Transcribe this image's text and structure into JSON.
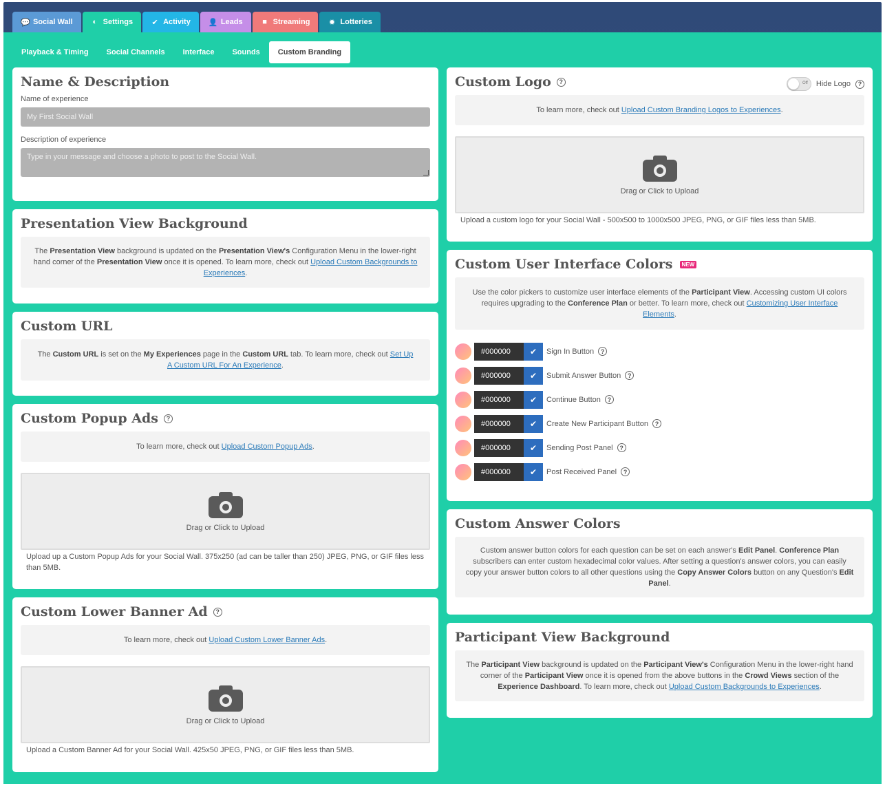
{
  "tabs_top": [
    {
      "label": "Social Wall",
      "icon": "chat-bubble-icon",
      "color": "#5b9ad6"
    },
    {
      "label": "Settings",
      "icon": "toggle-icon",
      "color": "#1fcfa8"
    },
    {
      "label": "Activity",
      "icon": "check-circle-icon",
      "color": "#23b6e6"
    },
    {
      "label": "Leads",
      "icon": "user-icon",
      "color": "#c58ee8"
    },
    {
      "label": "Streaming",
      "icon": "video-camera-icon",
      "color": "#f07a7a"
    },
    {
      "label": "Lotteries",
      "icon": "gear-burst-icon",
      "color": "#1a8fa6"
    }
  ],
  "subtabs": [
    "Playback & Timing",
    "Social Channels",
    "Interface",
    "Sounds",
    "Custom Branding"
  ],
  "name_desc": {
    "title": "Name & Description",
    "name_label": "Name of experience",
    "name_placeholder": "My First Social Wall",
    "desc_label": "Description of experience",
    "desc_placeholder": "Type in your message and choose a photo to post to the Social Wall."
  },
  "presentation_bg": {
    "title": "Presentation View Background",
    "t1": "The ",
    "b1": "Presentation View",
    "t2": " background is updated on the ",
    "b2": "Presentation View's",
    "t3": " Configuration Menu in the lower-right hand corner of the ",
    "b3": "Presentation View",
    "t4": " once it is opened. To learn more, check out ",
    "link": "Upload Custom Backgrounds to Experiences",
    "t5": "."
  },
  "custom_url": {
    "title": "Custom URL",
    "t1": "The ",
    "b1": "Custom URL",
    "t2": " is set on the ",
    "b2": "My Experiences",
    "t3": " page in the ",
    "b3": "Custom URL",
    "t4": " tab. To learn more, check out ",
    "link": "Set Up A Custom URL For An Experience",
    "t5": "."
  },
  "popup_ads": {
    "title": "Custom Popup Ads",
    "info_text": "To learn more, check out ",
    "link": "Upload Custom Popup Ads",
    "upload_text": "Drag or Click to Upload",
    "note": "Upload up a Custom Popup Ads for your Social Wall. 375x250 (ad can be taller than 250) JPEG, PNG, or GIF files less than 5MB."
  },
  "lower_banner": {
    "title": "Custom Lower Banner Ad",
    "info_text": "To learn more, check out ",
    "link": "Upload Custom Lower Banner Ads",
    "upload_text": "Drag or Click to Upload",
    "note": "Upload a Custom Banner Ad for your Social Wall. 425x50 JPEG, PNG, or GIF files less than 5MB."
  },
  "custom_logo": {
    "title": "Custom Logo",
    "toggle_off": "Off",
    "hide_label": "Hide Logo",
    "info_text": "To learn more, check out ",
    "link": "Upload Custom Branding Logos to Experiences",
    "upload_text": "Drag or Click to Upload",
    "note": "Upload a custom logo for your Social Wall - 500x500 to 1000x500 JPEG, PNG, or GIF files less than 5MB."
  },
  "ui_colors": {
    "title": "Custom User Interface Colors",
    "badge": "NEW",
    "t1": "Use the color pickers to customize user interface elements of the ",
    "b1": "Participant View",
    "t2": ". Accessing custom UI colors requires upgrading to the ",
    "b2": "Conference Plan",
    "t3": " or better. To learn more, check out ",
    "link": "Customizing User Interface Elements",
    "t4": ".",
    "rows": [
      {
        "hex": "#000000",
        "label": "Sign In Button"
      },
      {
        "hex": "#000000",
        "label": "Submit Answer Button"
      },
      {
        "hex": "#000000",
        "label": "Continue Button"
      },
      {
        "hex": "#000000",
        "label": "Create New Participant Button"
      },
      {
        "hex": "#000000",
        "label": "Sending Post Panel"
      },
      {
        "hex": "#000000",
        "label": "Post Received Panel"
      }
    ]
  },
  "answer_colors": {
    "title": "Custom Answer Colors",
    "t1": "Custom answer button colors for each question can be set on each answer's ",
    "b1": "Edit Panel",
    "t2": ". ",
    "b2": "Conference Plan",
    "t3": " subscribers can enter custom hexadecimal color values. After setting a question's answer colors, you can easily copy your answer button colors to all other questions using the ",
    "b3": "Copy Answer Colors",
    "t4": " button on any Question's ",
    "b4": "Edit Panel",
    "t5": "."
  },
  "participant_bg": {
    "title": "Participant View Background",
    "t1": "The ",
    "b1": "Participant View",
    "t2": " background is updated on the ",
    "b2": "Participant View's",
    "t3": " Configuration Menu in the lower-right hand corner of the ",
    "b3": "Participant View",
    "t4": " once it is opened from the above buttons in the ",
    "b4": "Crowd Views",
    "t5": " section of the ",
    "b5": "Experience Dashboard",
    "t6": ". To learn more, check out ",
    "link": "Upload Custom Backgrounds to Experiences",
    "t7": "."
  },
  "help_glyph": "?",
  "check_glyph": "✔"
}
